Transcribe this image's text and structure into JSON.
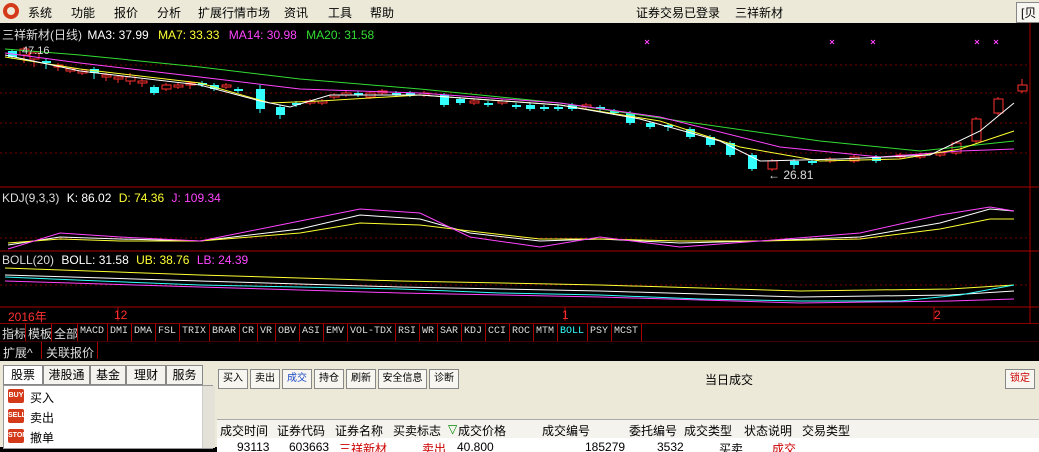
{
  "menubar": {
    "items": [
      "系统",
      "功能",
      "报价",
      "分析",
      "扩展行情市场",
      "资讯",
      "工具",
      "帮助"
    ],
    "status": "证券交易已登录",
    "stock_name": "三祥新材",
    "right_button": "[贝"
  },
  "chart": {
    "title": "三祥新材(日线)",
    "ma": [
      {
        "label": "MA3: 37.99",
        "color": "#ffffff"
      },
      {
        "label": "MA7: 33.33",
        "color": "#ffff33"
      },
      {
        "label": "MA14: 30.98",
        "color": "#ff44ff"
      },
      {
        "label": "MA20: 31.58",
        "color": "#33dd33"
      }
    ],
    "high_marker": "47.16",
    "low_marker": "← 26.81",
    "kdj": {
      "name": "KDJ(9,3,3)",
      "k": "K: 86.02",
      "d": "D: 74.36",
      "j": "J: 109.34"
    },
    "boll": {
      "name": "BOLL(20)",
      "boll": "BOLL: 31.58",
      "ub": "UB: 38.76",
      "lb": "LB: 24.39"
    },
    "date_labels": [
      "2016年",
      "12",
      "1",
      "2"
    ],
    "colors": {
      "up": "#ff3030",
      "down": "#33ffff",
      "ma3": "#ffffff",
      "ma7": "#ffff33",
      "ma14": "#ff44ff",
      "ma20": "#33dd33"
    }
  },
  "indicator_tabs": [
    "指标",
    "模板",
    "全部",
    "MACD",
    "DMI",
    "DMA",
    "FSL",
    "TRIX",
    "BRAR",
    "CR",
    "VR",
    "OBV",
    "ASI",
    "EMV",
    "VOL-TDX",
    "RSI",
    "WR",
    "SAR",
    "KDJ",
    "CCI",
    "ROC",
    "MTM",
    "BOLL",
    "PSY",
    "MCST"
  ],
  "active_indicator": "BOLL",
  "extra_tabs": [
    "扩展^",
    "关联报价"
  ],
  "trade": {
    "left_tabs": [
      "股票",
      "港股通",
      "基金",
      "理财",
      "服务"
    ],
    "actions": [
      {
        "label": "买入",
        "icon": "BUY",
        "color": "#d43a1a"
      },
      {
        "label": "卖出",
        "icon": "SELL",
        "color": "#d43a1a"
      },
      {
        "label": "撤单",
        "icon": "STOP",
        "color": "#d43a1a"
      }
    ],
    "toolbar": [
      "买入",
      "卖出",
      "成交",
      "持仓",
      "刷新",
      "安全信息",
      "诊断"
    ],
    "active_toolbar": "成交",
    "panel_title": "当日成交",
    "lock_button": "锁定",
    "columns": [
      "成交时间",
      "证券代码",
      "证券名称",
      "买卖标志",
      "成交价格",
      "成交编号",
      "委托编号",
      "成交类型",
      "状态说明",
      "交易类型"
    ],
    "rows": [
      [
        "93113",
        "603663",
        "三祥新材",
        "卖出",
        "40.800",
        "185279",
        "3532",
        "买卖",
        "成交",
        ""
      ]
    ]
  }
}
